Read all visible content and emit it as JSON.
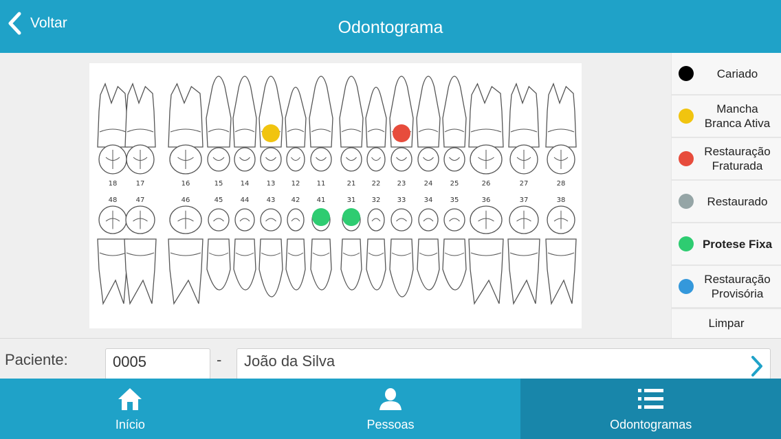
{
  "header": {
    "back_label": "Voltar",
    "title": "Odontograma"
  },
  "odontogram": {
    "upper": [
      "18",
      "17",
      "16",
      "15",
      "14",
      "13",
      "12",
      "11",
      "21",
      "22",
      "23",
      "24",
      "25",
      "26",
      "27",
      "28"
    ],
    "lower": [
      "48",
      "47",
      "46",
      "45",
      "44",
      "43",
      "42",
      "41",
      "31",
      "32",
      "33",
      "34",
      "35",
      "36",
      "37",
      "38"
    ],
    "marks": [
      {
        "tooth": "13",
        "condition": "Mancha Branca Ativa"
      },
      {
        "tooth": "23",
        "condition": "Restauração Fraturada"
      },
      {
        "tooth": "41",
        "condition": "Protese Fixa"
      },
      {
        "tooth": "31",
        "condition": "Protese Fixa"
      }
    ]
  },
  "legend": {
    "items": [
      {
        "label": "Cariado",
        "color": "#000000"
      },
      {
        "label": "Mancha Branca Ativa",
        "color": "#f1c40f"
      },
      {
        "label": "Restauração Fraturada",
        "color": "#e74c3c"
      },
      {
        "label": "Restaurado",
        "color": "#95a5a6"
      },
      {
        "label": "Protese Fixa",
        "color": "#2ecc71"
      },
      {
        "label": "Restauração Provisória",
        "color": "#3498db"
      }
    ],
    "selected": "Protese Fixa",
    "clear_label": "Limpar"
  },
  "patient": {
    "label": "Paciente:",
    "code": "0005",
    "separator": "-",
    "name": "João da Silva"
  },
  "nav": {
    "items": [
      {
        "label": "Início",
        "icon": "home-icon"
      },
      {
        "label": "Pessoas",
        "icon": "person-icon"
      },
      {
        "label": "Odontogramas",
        "icon": "list-icon"
      }
    ],
    "active": "Odontogramas"
  }
}
